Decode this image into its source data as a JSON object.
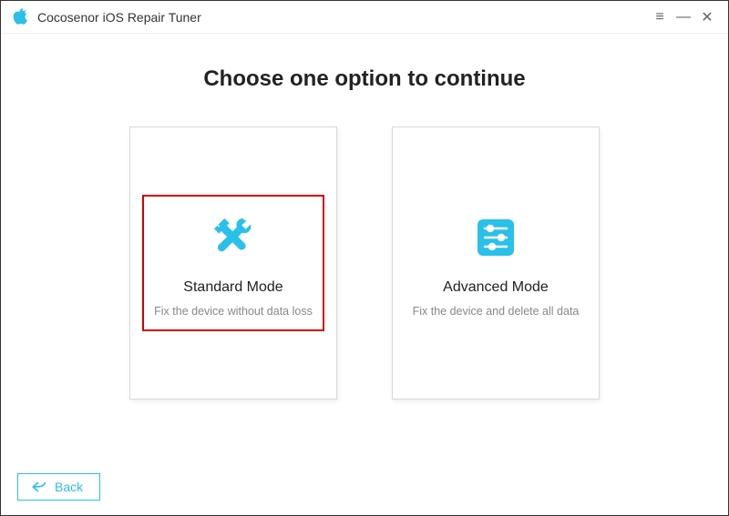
{
  "titlebar": {
    "app_title": "Cocosenor iOS Repair Tuner",
    "menu": "≡",
    "minimize": "—",
    "close": "✕"
  },
  "heading": "Choose one option to continue",
  "cards": {
    "standard": {
      "title": "Standard Mode",
      "desc": "Fix the device without data loss"
    },
    "advanced": {
      "title": "Advanced Mode",
      "desc": "Fix the device and delete all data"
    }
  },
  "back_label": "Back",
  "accent_color": "#29c0ea"
}
